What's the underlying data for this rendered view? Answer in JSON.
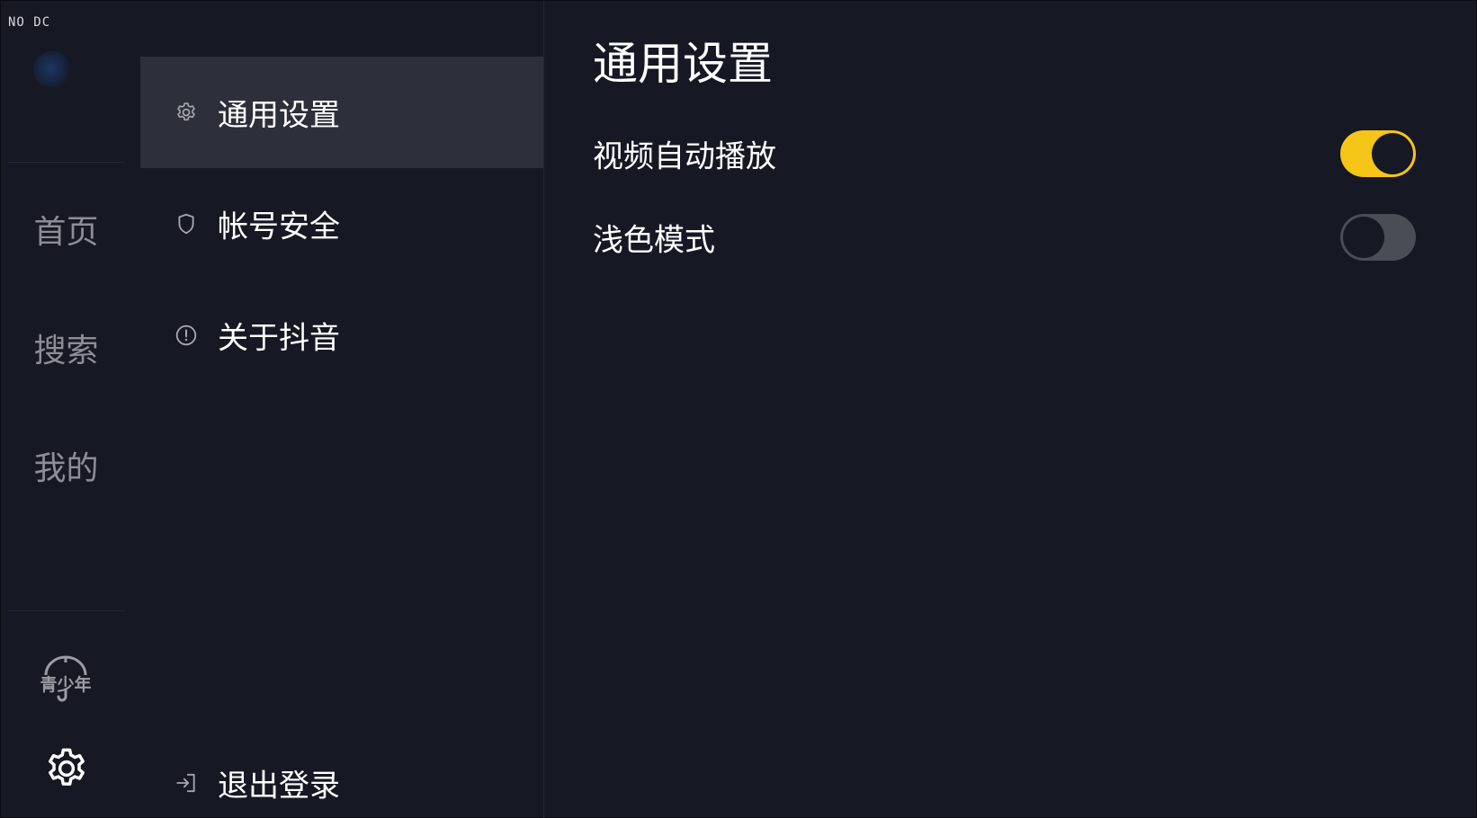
{
  "debug_tag": "NO DC",
  "rail": {
    "nav": [
      {
        "label": "首页"
      },
      {
        "label": "搜索"
      },
      {
        "label": "我的"
      }
    ],
    "teen_mode_label": "青少年",
    "icons": {
      "logo": "app-logo-icon",
      "teen": "umbrella-icon",
      "settings": "gear-icon"
    }
  },
  "settings_menu": {
    "items": [
      {
        "label": "通用设置",
        "icon": "gear-icon",
        "active": true
      },
      {
        "label": "帐号安全",
        "icon": "shield-icon",
        "active": false
      },
      {
        "label": "关于抖音",
        "icon": "info-circle-icon",
        "active": false
      }
    ],
    "logout": {
      "label": "退出登录",
      "icon": "logout-arrow-icon"
    }
  },
  "detail": {
    "title": "通用设置",
    "settings": [
      {
        "label": "视频自动播放",
        "enabled": true
      },
      {
        "label": "浅色模式",
        "enabled": false
      }
    ]
  },
  "colors": {
    "background": "#161824",
    "active_menu": "#2d2f3a",
    "toggle_on": "#f5c518",
    "toggle_off": "#4a4c56",
    "rail_text": "#8c8d96"
  }
}
